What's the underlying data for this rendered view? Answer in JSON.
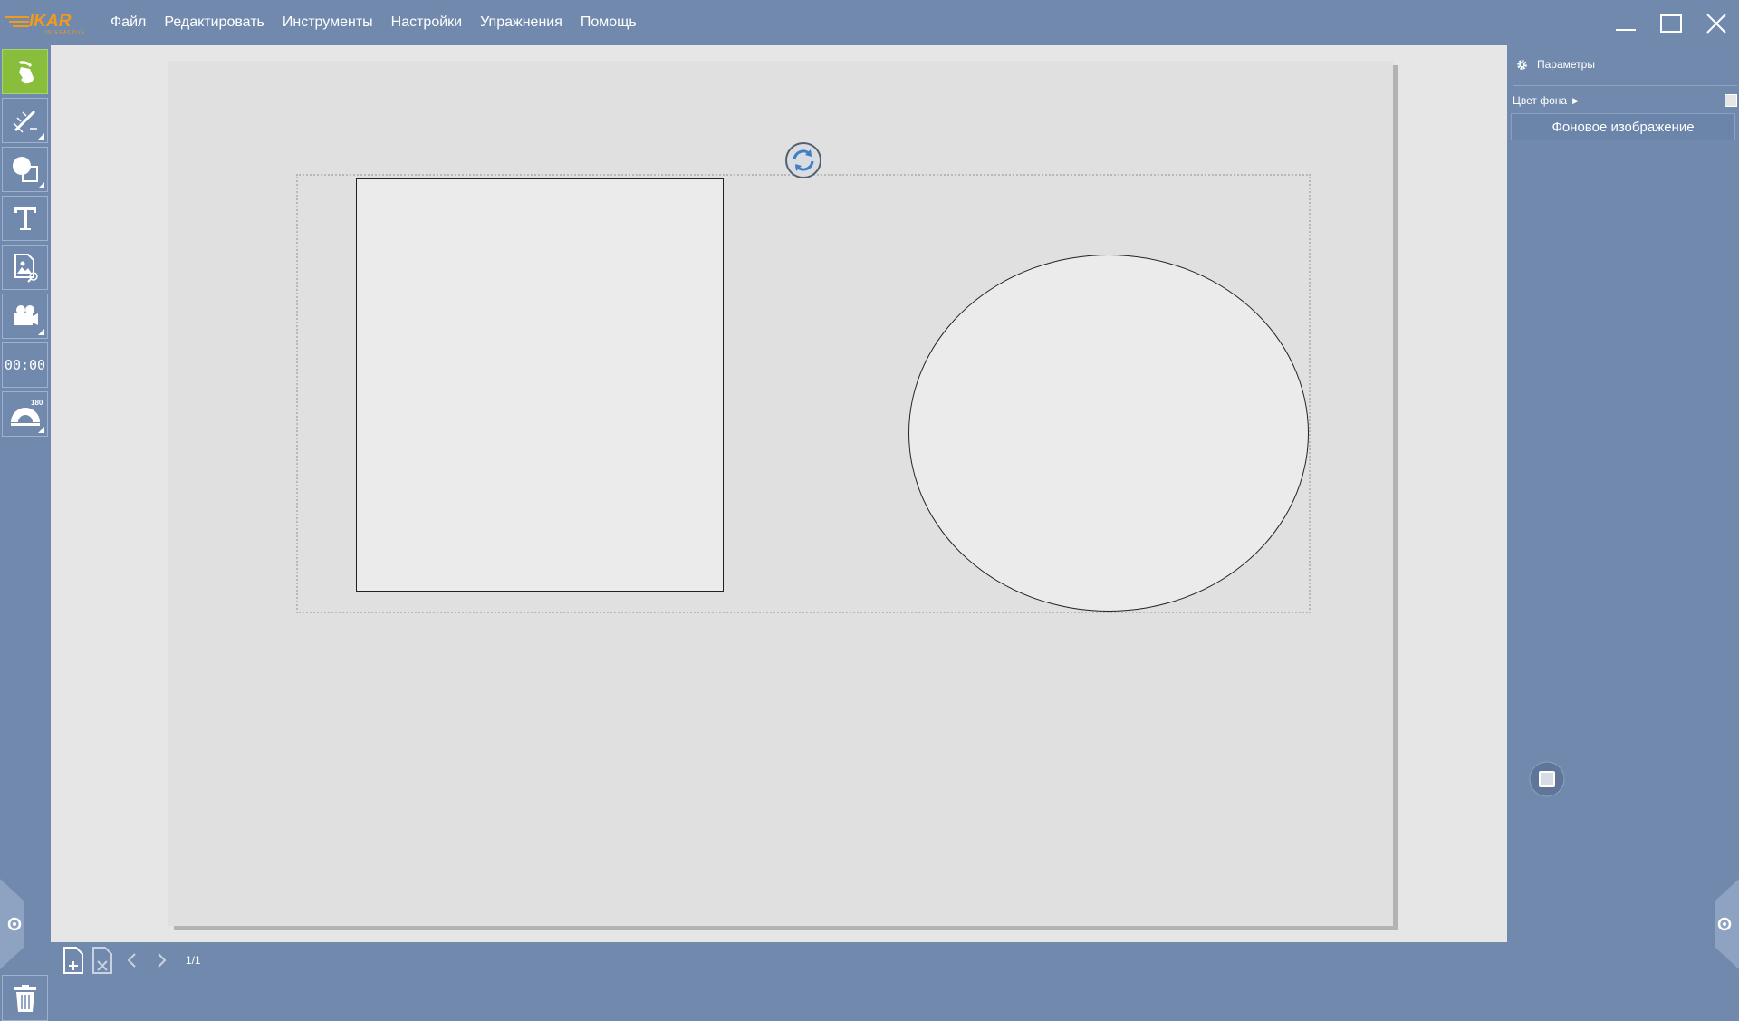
{
  "app": {
    "logo_text": "IKAR",
    "logo_sub": "INTERACTIVE",
    "brand_color": "#f29a1e"
  },
  "menu": {
    "items": [
      {
        "label": "Файл"
      },
      {
        "label": "Редактировать"
      },
      {
        "label": "Инструменты"
      },
      {
        "label": "Настройки"
      },
      {
        "label": "Упражнения"
      },
      {
        "label": "Помощь"
      }
    ]
  },
  "window_controls": [
    "minimize-icon",
    "maximize-icon",
    "close-icon"
  ],
  "toolbar": {
    "tools": [
      {
        "name": "select-tool",
        "icon": "hand-pointer-icon",
        "active": true
      },
      {
        "name": "pen-tool",
        "icon": "pencil-ruler-icon",
        "active": false
      },
      {
        "name": "shapes-tool",
        "icon": "shapes-icon",
        "active": false
      },
      {
        "name": "text-tool",
        "icon": "text-icon",
        "active": false
      },
      {
        "name": "image-tool",
        "icon": "image-search-icon",
        "active": false
      },
      {
        "name": "video-tool",
        "icon": "camera-icon",
        "active": false
      },
      {
        "name": "timer-tool",
        "icon": "timer-icon",
        "active": false
      },
      {
        "name": "protractor-tool",
        "icon": "protractor-icon",
        "active": false
      }
    ],
    "timer_label": "00:00",
    "protractor_label": "180",
    "active_color": "#89be3c"
  },
  "canvas": {
    "background": "#e0e0e0",
    "objects": [
      {
        "type": "rectangle"
      },
      {
        "type": "ellipse"
      }
    ]
  },
  "right_panel": {
    "header": "Параметры",
    "bg_color_label": "Цвет фона",
    "bg_color_value": "#e6e6e6",
    "bg_image_button": "Фоновое изображение"
  },
  "bottom_bar": {
    "page_counter": "1/1"
  },
  "colors": {
    "chrome": "#7189ad",
    "workarea": "#e6e6e6"
  }
}
